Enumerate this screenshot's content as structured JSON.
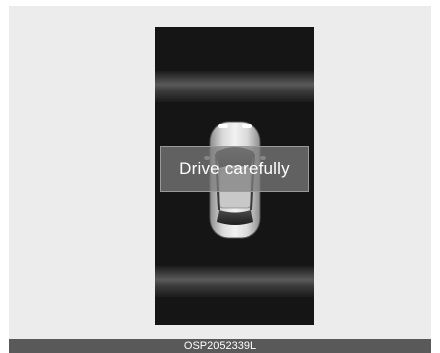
{
  "display": {
    "message": "Drive carefully",
    "vehicle_icon": "car-top-view-icon"
  },
  "caption": {
    "code": "OSP2052339L"
  },
  "colors": {
    "screen_background": "#151515",
    "figure_background": "#ececec",
    "caption_background": "#595959"
  }
}
